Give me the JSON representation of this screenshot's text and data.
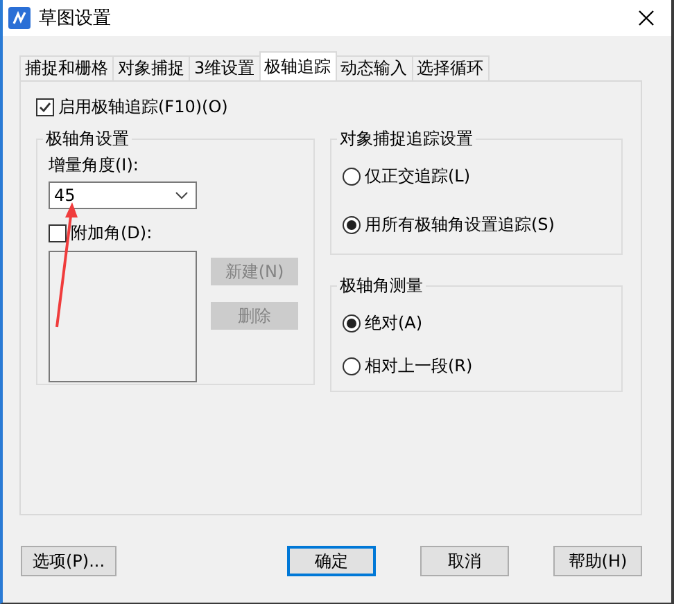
{
  "window": {
    "title": "草图设置"
  },
  "tabs": [
    {
      "label": "捕捉和栅格",
      "selected": false
    },
    {
      "label": "对象捕捉",
      "selected": false
    },
    {
      "label": "3维设置",
      "selected": false
    },
    {
      "label": "极轴追踪",
      "selected": true
    },
    {
      "label": "动态输入",
      "selected": false
    },
    {
      "label": "选择循环",
      "selected": false
    }
  ],
  "polar_tracking": {
    "label": "启用极轴追踪(F10)(O)",
    "checked": true
  },
  "polar_angle_settings": {
    "title": "极轴角设置",
    "increment_label": "增量角度(I):",
    "increment_value": "45",
    "additional_angles": {
      "label": "附加角(D):",
      "checked": false
    },
    "buttons": [
      {
        "label": "新建(N)",
        "disabled": true
      },
      {
        "label": "删除",
        "disabled": true
      }
    ]
  },
  "object_snap_tracking": {
    "title": "对象捕捉追踪设置",
    "options": [
      {
        "label": "仅正交追踪(L)",
        "selected": false
      },
      {
        "label": "用所有极轴角设置追踪(S)",
        "selected": true
      }
    ]
  },
  "polar_angle_measurement": {
    "title": "极轴角测量",
    "options": [
      {
        "label": "绝对(A)",
        "selected": true
      },
      {
        "label": "相对上一段(R)",
        "selected": false
      }
    ]
  },
  "buttons": [
    {
      "label": "选项(P)...",
      "default": false
    },
    {
      "label": "确定",
      "default": true
    },
    {
      "label": "取消",
      "default": false
    },
    {
      "label": "帮助(H)",
      "default": false
    }
  ]
}
